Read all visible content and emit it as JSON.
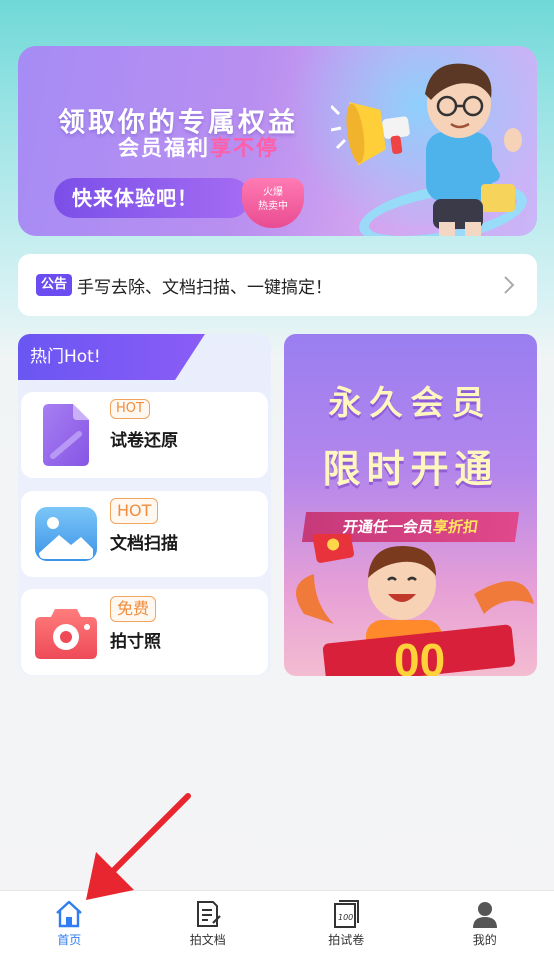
{
  "banner": {
    "title": "领取你的专属权益",
    "subtitle_main": "会员福利",
    "subtitle_accent": "享不停",
    "cta": "快来体验吧！",
    "hot_tag_line1": "火爆",
    "hot_tag_line2": "热卖中"
  },
  "notice": {
    "badge": "公告",
    "text": "手写去除、文档扫描、一键搞定！"
  },
  "hot": {
    "header": "热门Hot!",
    "items": [
      {
        "tag": "HOT",
        "label": "试卷还原",
        "icon": "document-icon"
      },
      {
        "tag": "HOT",
        "label": "文档扫描",
        "icon": "image-icon"
      },
      {
        "tag": "免费",
        "label": "拍寸照",
        "icon": "camera-icon"
      }
    ]
  },
  "member": {
    "line1": "永久会员",
    "line2": "限时开通",
    "strip_main": "开通任一会员",
    "strip_accent": "享折扣"
  },
  "tabbar": {
    "tabs": [
      {
        "label": "首页",
        "icon": "home-icon",
        "active": true
      },
      {
        "label": "拍文档",
        "icon": "document-scan-icon",
        "active": false
      },
      {
        "label": "拍试卷",
        "icon": "exam-paper-icon",
        "active": false
      },
      {
        "label": "我的",
        "icon": "profile-icon",
        "active": false
      }
    ]
  },
  "colors": {
    "accent": "#6a4cf0",
    "tab_active": "#2f7df0",
    "hot_tag": "#f08c3c"
  }
}
